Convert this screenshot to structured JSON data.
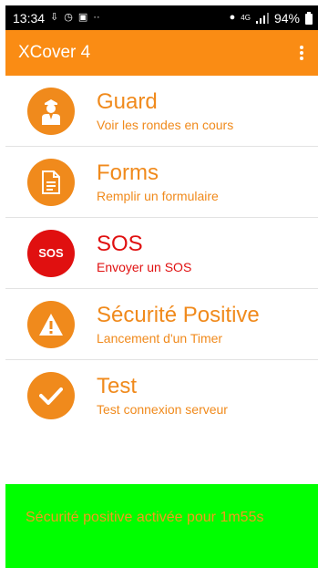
{
  "status_bar": {
    "time": "13:34",
    "battery": "94%",
    "network": "4G",
    "left_icons": [
      "download-icon",
      "alarm-icon",
      "image-icon",
      "more-dots-icon"
    ],
    "right_icons": [
      "location-icon",
      "network-4g-icon",
      "signal-icon",
      "battery-icon"
    ]
  },
  "app_bar": {
    "title": "XCover 4",
    "color": "#fa8c14"
  },
  "menu": {
    "items": [
      {
        "title": "Guard",
        "subtitle": "Voir les rondes en cours",
        "icon": "guard-icon"
      },
      {
        "title": "Forms",
        "subtitle": "Remplir un formulaire",
        "icon": "document-icon"
      },
      {
        "title": "SOS",
        "subtitle": "Envoyer un SOS",
        "icon": "sos-icon",
        "icon_label": "SOS"
      },
      {
        "title": "Sécurité Positive",
        "subtitle": "Lancement d'un Timer",
        "icon": "warning-icon"
      },
      {
        "title": "Test",
        "subtitle": "Test connexion serveur",
        "icon": "check-icon"
      }
    ]
  },
  "banner": {
    "text": "Sécurité positive activée pour 1m55s",
    "background": "#00ff00"
  },
  "colors": {
    "accent": "#f08a1c",
    "sos": "#e01010"
  }
}
